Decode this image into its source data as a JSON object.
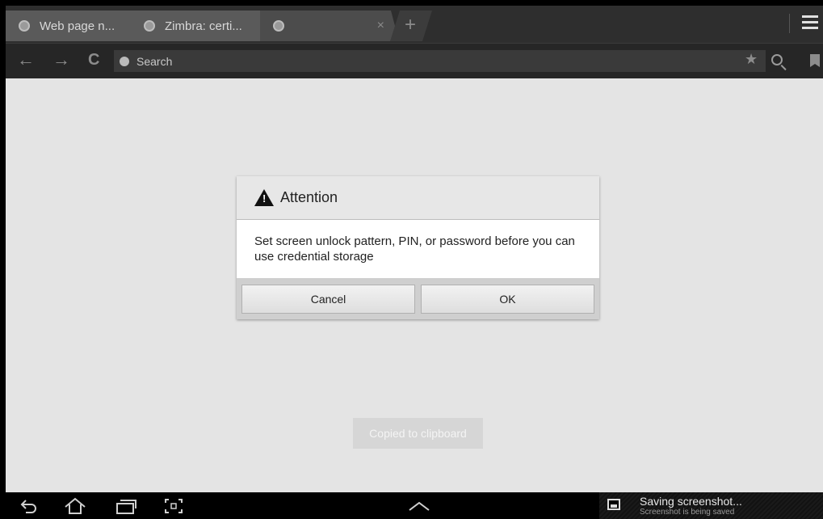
{
  "browser": {
    "tabs": [
      {
        "title": "Web page n...",
        "active": false
      },
      {
        "title": "Zimbra: certi...",
        "active": false
      },
      {
        "title": "",
        "active": true
      }
    ],
    "new_tab_glyph": "+",
    "close_glyph": "×",
    "omnibox": {
      "placeholder": "Search"
    }
  },
  "dialog": {
    "title": "Attention",
    "icon": "warning-icon",
    "message": "Set screen unlock pattern, PIN, or password before you can use credential storage",
    "buttons": {
      "cancel": "Cancel",
      "ok": "OK"
    }
  },
  "toast": {
    "text": "Copied to clipboard"
  },
  "notification": {
    "title": "Saving screenshot...",
    "subtitle": "Screenshot is being saved",
    "icon": "image-icon"
  },
  "colors": {
    "page_bg": "#e4e4e4",
    "toolbar_bg": "#262626",
    "dialog_header": "#e7e7e7"
  }
}
